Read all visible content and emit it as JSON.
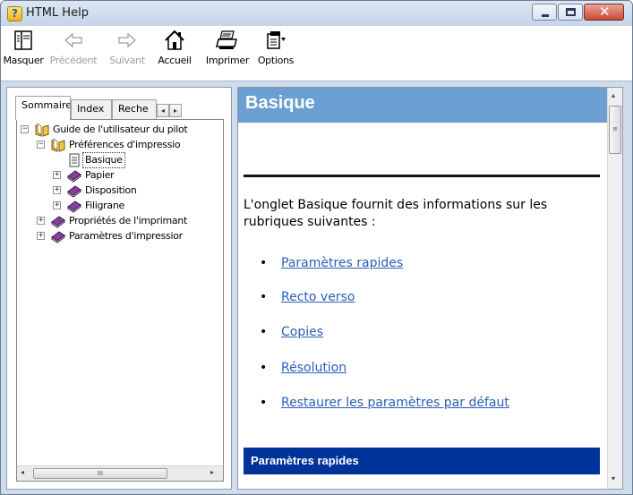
{
  "window": {
    "title": "HTML Help",
    "app_icon_glyph": "?",
    "controls": {
      "minimize": "minimize-icon",
      "maximize": "maximize-icon",
      "close": "close-icon"
    }
  },
  "toolbar": {
    "items": [
      {
        "label": "Masquer",
        "icon": "hide-pane-icon",
        "enabled": true
      },
      {
        "label": "Précédent",
        "icon": "back-arrow-icon",
        "enabled": false
      },
      {
        "label": "Suivant",
        "icon": "forward-arrow-icon",
        "enabled": false
      },
      {
        "label": "Accueil",
        "icon": "home-icon",
        "enabled": true
      },
      {
        "label": "Imprimer",
        "icon": "printer-icon",
        "enabled": true
      },
      {
        "label": "Options",
        "icon": "options-icon",
        "enabled": true
      }
    ]
  },
  "nav": {
    "tabs": [
      {
        "label": "Sommaire",
        "active": true
      },
      {
        "label": "Index",
        "active": false
      },
      {
        "label": "Reche",
        "active": false
      }
    ],
    "tab_scroll_left": "◂",
    "tab_scroll_right": "▸",
    "tree": [
      {
        "label": "Guide de l'utilisateur du pilot",
        "level": 0,
        "expander": "⊟",
        "icon": "open-book-icon"
      },
      {
        "label": "Préférences d'impressio",
        "level": 1,
        "expander": "⊟",
        "icon": "open-book-icon"
      },
      {
        "label": "Basique",
        "level": 2,
        "expander": "",
        "icon": "page-icon",
        "selected": true
      },
      {
        "label": "Papier",
        "level": 2,
        "expander": "⊞",
        "icon": "closed-book-icon"
      },
      {
        "label": "Disposition",
        "level": 2,
        "expander": "⊞",
        "icon": "closed-book-icon"
      },
      {
        "label": "Filigrane",
        "level": 2,
        "expander": "⊞",
        "icon": "closed-book-icon"
      },
      {
        "label": "Propriétés de l'imprimant",
        "level": 1,
        "expander": "⊞",
        "icon": "closed-book-icon"
      },
      {
        "label": "Paramètres d'impressior",
        "level": 1,
        "expander": "⊞",
        "icon": "closed-book-icon"
      }
    ],
    "hscroll": {
      "left": "◂",
      "right": "▸",
      "thumb": "III"
    }
  },
  "content": {
    "heading": "Basique",
    "intro": "L'onglet Basique fournit des informations sur les rubriques suivantes :",
    "bullet": "•",
    "links": [
      "Paramètres rapides",
      "Recto verso",
      "Copies",
      "Résolution",
      "Restaurer les paramètres par défaut"
    ],
    "section_heading": "Paramètres rapides",
    "vscroll": {
      "up": "▴",
      "down": "▾",
      "thumb": "≡"
    }
  },
  "colors": {
    "heading_bar": "#6b9fd1",
    "section_bar": "#003399",
    "link": "#2b5db7"
  }
}
